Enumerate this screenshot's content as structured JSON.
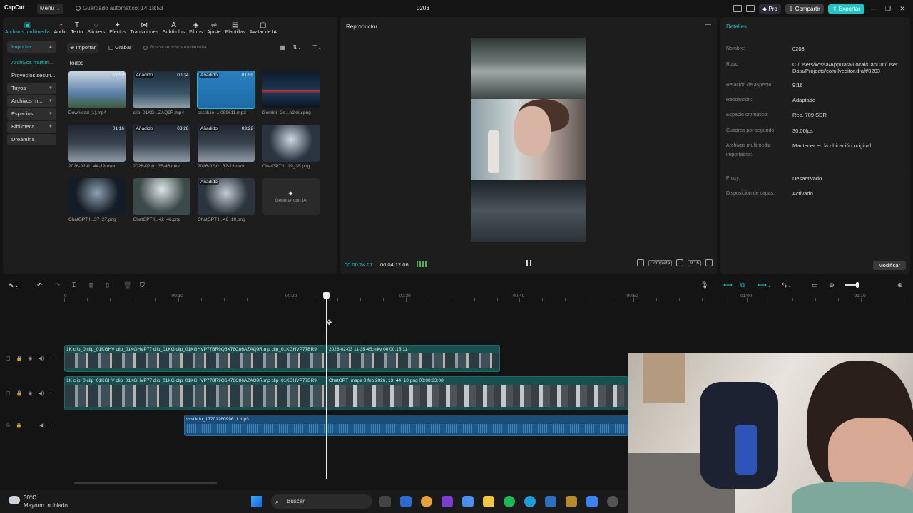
{
  "titlebar": {
    "logo": "CapCut",
    "menu_label": "Menú",
    "autosave": "Guardado automático: 14:18:53",
    "project_title": "0203",
    "pro_label": "Pro",
    "share_label": "Compartir",
    "export_label": "Exportar"
  },
  "toptabs": [
    {
      "label": "Archivos multimedia",
      "icon": "media-icon",
      "glyph": "▣"
    },
    {
      "label": "Audio",
      "icon": "audio-icon",
      "glyph": "◔"
    },
    {
      "label": "Texto",
      "icon": "text-icon",
      "glyph": "T"
    },
    {
      "label": "Stickers",
      "icon": "sticker-icon",
      "glyph": "◌"
    },
    {
      "label": "Efectos",
      "icon": "effects-icon",
      "glyph": "✦"
    },
    {
      "label": "Transiciones",
      "icon": "transitions-icon",
      "glyph": "⋈"
    },
    {
      "label": "Subtítulos",
      "icon": "subtitles-icon",
      "glyph": "A"
    },
    {
      "label": "Filtros",
      "icon": "filters-icon",
      "glyph": "◈"
    },
    {
      "label": "Ajuste",
      "icon": "adjust-icon",
      "glyph": "⇌"
    },
    {
      "label": "Plantillas",
      "icon": "templates-icon",
      "glyph": "▤"
    },
    {
      "label": "Avatar de IA",
      "icon": "avatar-icon",
      "glyph": "▢"
    }
  ],
  "sidenav": [
    {
      "label": "Importar"
    },
    {
      "label": "Archivos multim..."
    },
    {
      "label": "Proyectos secun..."
    },
    {
      "label": "Tuyos"
    },
    {
      "label": "Archivos m..."
    },
    {
      "label": "Espacios"
    },
    {
      "label": "Biblioteca"
    },
    {
      "label": "Dreamina"
    }
  ],
  "media_toolbar": {
    "import_label": "Importar",
    "record_label": "Grabar",
    "search_placeholder": "Buscar archivos multimedia"
  },
  "section_label": "Todos",
  "media_items": [
    {
      "name": "Download (1).mp4",
      "badge": "",
      "duration": "01:59"
    },
    {
      "name": "clip_01KG...ZAQ9R.mp4",
      "badge": "Añadido",
      "duration": "00:34"
    },
    {
      "name": "ssstik.io_...099611.mp3",
      "badge": "Añadido",
      "duration": "01:59"
    },
    {
      "name": "Gemini_Ge...h2kku.png",
      "badge": "",
      "duration": ""
    },
    {
      "name": "2026-02-0...44-19.mkv",
      "badge": "",
      "duration": "01:16"
    },
    {
      "name": "2026-02-0...35-45.mkv",
      "badge": "Añadido",
      "duration": "03:28"
    },
    {
      "name": "2026-02-0...32-13.mkv",
      "badge": "Añadido",
      "duration": "03:22"
    },
    {
      "name": "ChatGPT I...29_35.png",
      "badge": "",
      "duration": ""
    },
    {
      "name": "ChatGPT I...37_27.png",
      "badge": "",
      "duration": ""
    },
    {
      "name": "ChatGPT I...42_46.png",
      "badge": "",
      "duration": ""
    },
    {
      "name": "ChatGPT I...46_10.png",
      "badge": "Añadido",
      "duration": ""
    }
  ],
  "generate_label": "Generar con IA",
  "player": {
    "title": "Reproductor",
    "current_time": "00:00:24:07",
    "total_time": "00:04:12:06",
    "quality_label": "Completa",
    "ratio_label": "9:16"
  },
  "details": {
    "title": "Detalles",
    "rows": [
      {
        "label": "Nombre:",
        "value": "0203"
      },
      {
        "label": "Ruta:",
        "value": "C:/Users/kossa/AppData/Local/CapCut/User Data/Projects/com.lveditor.draft/0203"
      },
      {
        "label": "Relación de aspecto:",
        "value": "9:16"
      },
      {
        "label": "Resolución:",
        "value": "Adaptado"
      },
      {
        "label": "Espacio cromático:",
        "value": "Rec. 709 SDR"
      },
      {
        "label": "Cuadros por segundo:",
        "value": "30.00fps"
      },
      {
        "label": "Archivos multimedia importados:",
        "value": "Mantener en la ubicación original"
      },
      {
        "label": "Proxy:",
        "value": "Desactivado"
      },
      {
        "label": "Disposición de capas:",
        "value": "Activado"
      }
    ],
    "modify_label": "Modificar"
  },
  "timeline": {
    "ruler": [
      "0",
      "00:10",
      "00:20",
      "00:30",
      "00:40",
      "00:50",
      "01:00",
      "01:10"
    ],
    "track1_label": "1K  clip_0  clip_01KGHV  clip_01KGHVP77  clip_01KG  clip_01KGHVP77BR9Q6X78C86AZAQ9R.mp  clip_01KGHVP77BR9",
    "track1_clip2": "2026-02-03 11-35-45.mkv   00:00:15:11",
    "track2_label": "1K  clip_0  clip_01KGHV  clip_01KGHVP77  clip_01KG  clip_01KGHVP77BR9Q6X78C86AZAQ9R.mp  clip_01KGHVP77BR9",
    "track2_clip2": "ChatGPT Image 3 feb 2026, 13_44_10.png   00:00:33:08",
    "audio_label": "ssstik.io_1770126099611.mp3"
  },
  "taskbar": {
    "temperature": "30°C",
    "weather": "Mayorm. nublado",
    "search_label": "Buscar"
  },
  "colors": {
    "accent": "#21c4c4",
    "video_clip": "#17504f",
    "audio_clip": "#1a4e7a"
  }
}
